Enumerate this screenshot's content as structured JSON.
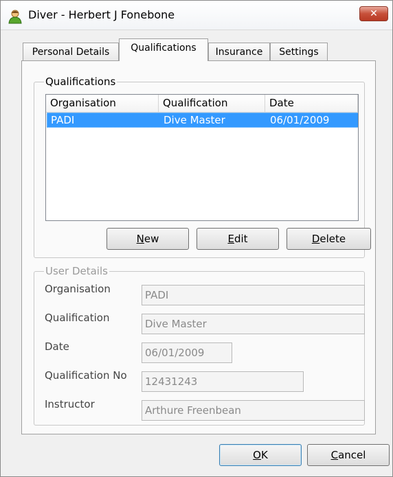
{
  "window": {
    "title": "Diver - Herbert J Fonebone",
    "close_glyph": "✕"
  },
  "tabs": [
    {
      "label": "Personal Details",
      "active": false
    },
    {
      "label": "Qualifications",
      "active": true
    },
    {
      "label": "Insurance",
      "active": false
    },
    {
      "label": "Settings",
      "active": false
    }
  ],
  "qualifications": {
    "group_title": "Qualifications",
    "columns": [
      "Organisation",
      "Qualification",
      "Date"
    ],
    "rows": [
      {
        "organisation": "PADI",
        "qualification": "Dive Master",
        "date": "06/01/2009",
        "selected": true
      }
    ],
    "buttons": {
      "new": {
        "mnemonic": "N",
        "rest": "ew"
      },
      "edit": {
        "mnemonic": "E",
        "rest": "dit"
      },
      "delete": {
        "mnemonic": "D",
        "rest": "elete"
      }
    }
  },
  "user_details": {
    "group_title": "User Details",
    "organisation": {
      "label": "Organisation",
      "value": "PADI"
    },
    "qualification": {
      "label": "Qualification",
      "value": "Dive Master"
    },
    "date": {
      "label": "Date",
      "value": "06/01/2009"
    },
    "qualification_no": {
      "label": "Qualification No",
      "value": "12431243"
    },
    "instructor": {
      "label": "Instructor",
      "value": "Arthure Freenbean"
    }
  },
  "dialog_buttons": {
    "ok": {
      "mnemonic": "O",
      "rest": "K"
    },
    "cancel": {
      "mnemonic": "C",
      "rest": "ancel"
    }
  },
  "colors": {
    "selection": "#3399ff",
    "close_button": "#c7503a"
  }
}
